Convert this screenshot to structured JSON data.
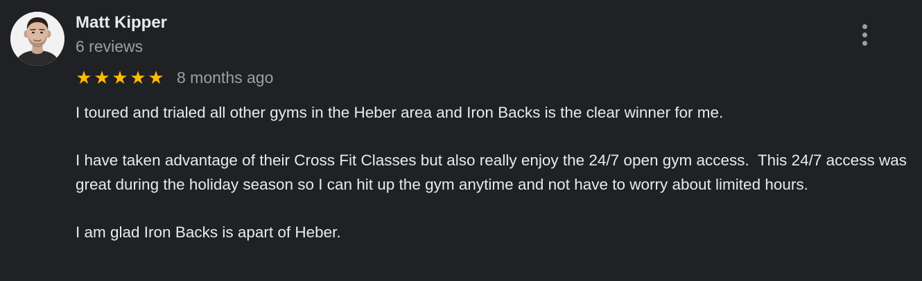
{
  "review": {
    "author": {
      "name": "Matt Kipper",
      "review_count": "6 reviews",
      "avatar": "profile-photo"
    },
    "rating": {
      "stars": 5,
      "max_stars": 5,
      "star_icon": "star-icon",
      "star_color": "#fbbc04"
    },
    "date": "8 months ago",
    "body": {
      "paragraphs": [
        "I toured and trialed all other gyms in the Heber area and Iron Backs is the clear winner for me.",
        "I have taken advantage of their Cross Fit Classes but also really enjoy the 24/7 open gym access.  This 24/7 access was great during the holiday season so I can hit up the gym anytime and not have to worry about limited hours.",
        "I am glad Iron Backs is apart of Heber."
      ]
    },
    "menu": {
      "icon": "more-vertical-icon"
    }
  },
  "colors": {
    "background": "#202124",
    "primary_text": "#e8eaed",
    "secondary_text": "#9aa0a6",
    "star": "#fbbc04"
  }
}
